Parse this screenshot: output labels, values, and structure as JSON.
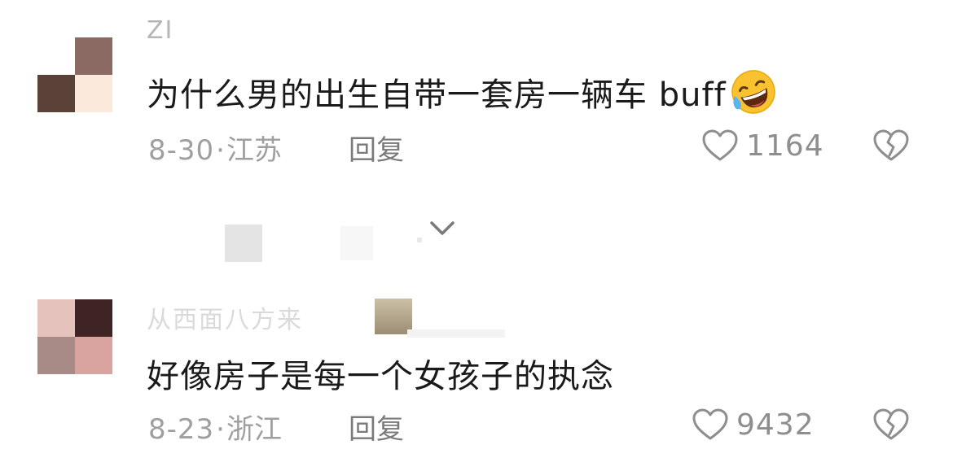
{
  "comments": [
    {
      "username": "ZI",
      "text": "为什么男的出生自带一套房一辆车 buff",
      "emoji": "rolling-on-floor-laughing",
      "date": "8-30",
      "location": "江苏",
      "reply_label": "回复",
      "like_count": "1164",
      "avatar_colors": [
        "#ffffff",
        "#8a6a62",
        "#5a4238",
        "#fbe9dc"
      ]
    },
    {
      "username": "从西面八方来",
      "text": "好像房子是每一个女孩子的执念",
      "date": "8-23",
      "location": "浙江",
      "reply_label": "回复",
      "like_count": "9432",
      "avatar_colors": [
        "#e6c2bc",
        "#3e2424",
        "#a88a86",
        "#d9a4a0"
      ]
    }
  ],
  "separator": "·",
  "colors": {
    "text": "#1a1a1a",
    "meta": "#9f9f9f",
    "icon": "#8e8e8e"
  }
}
